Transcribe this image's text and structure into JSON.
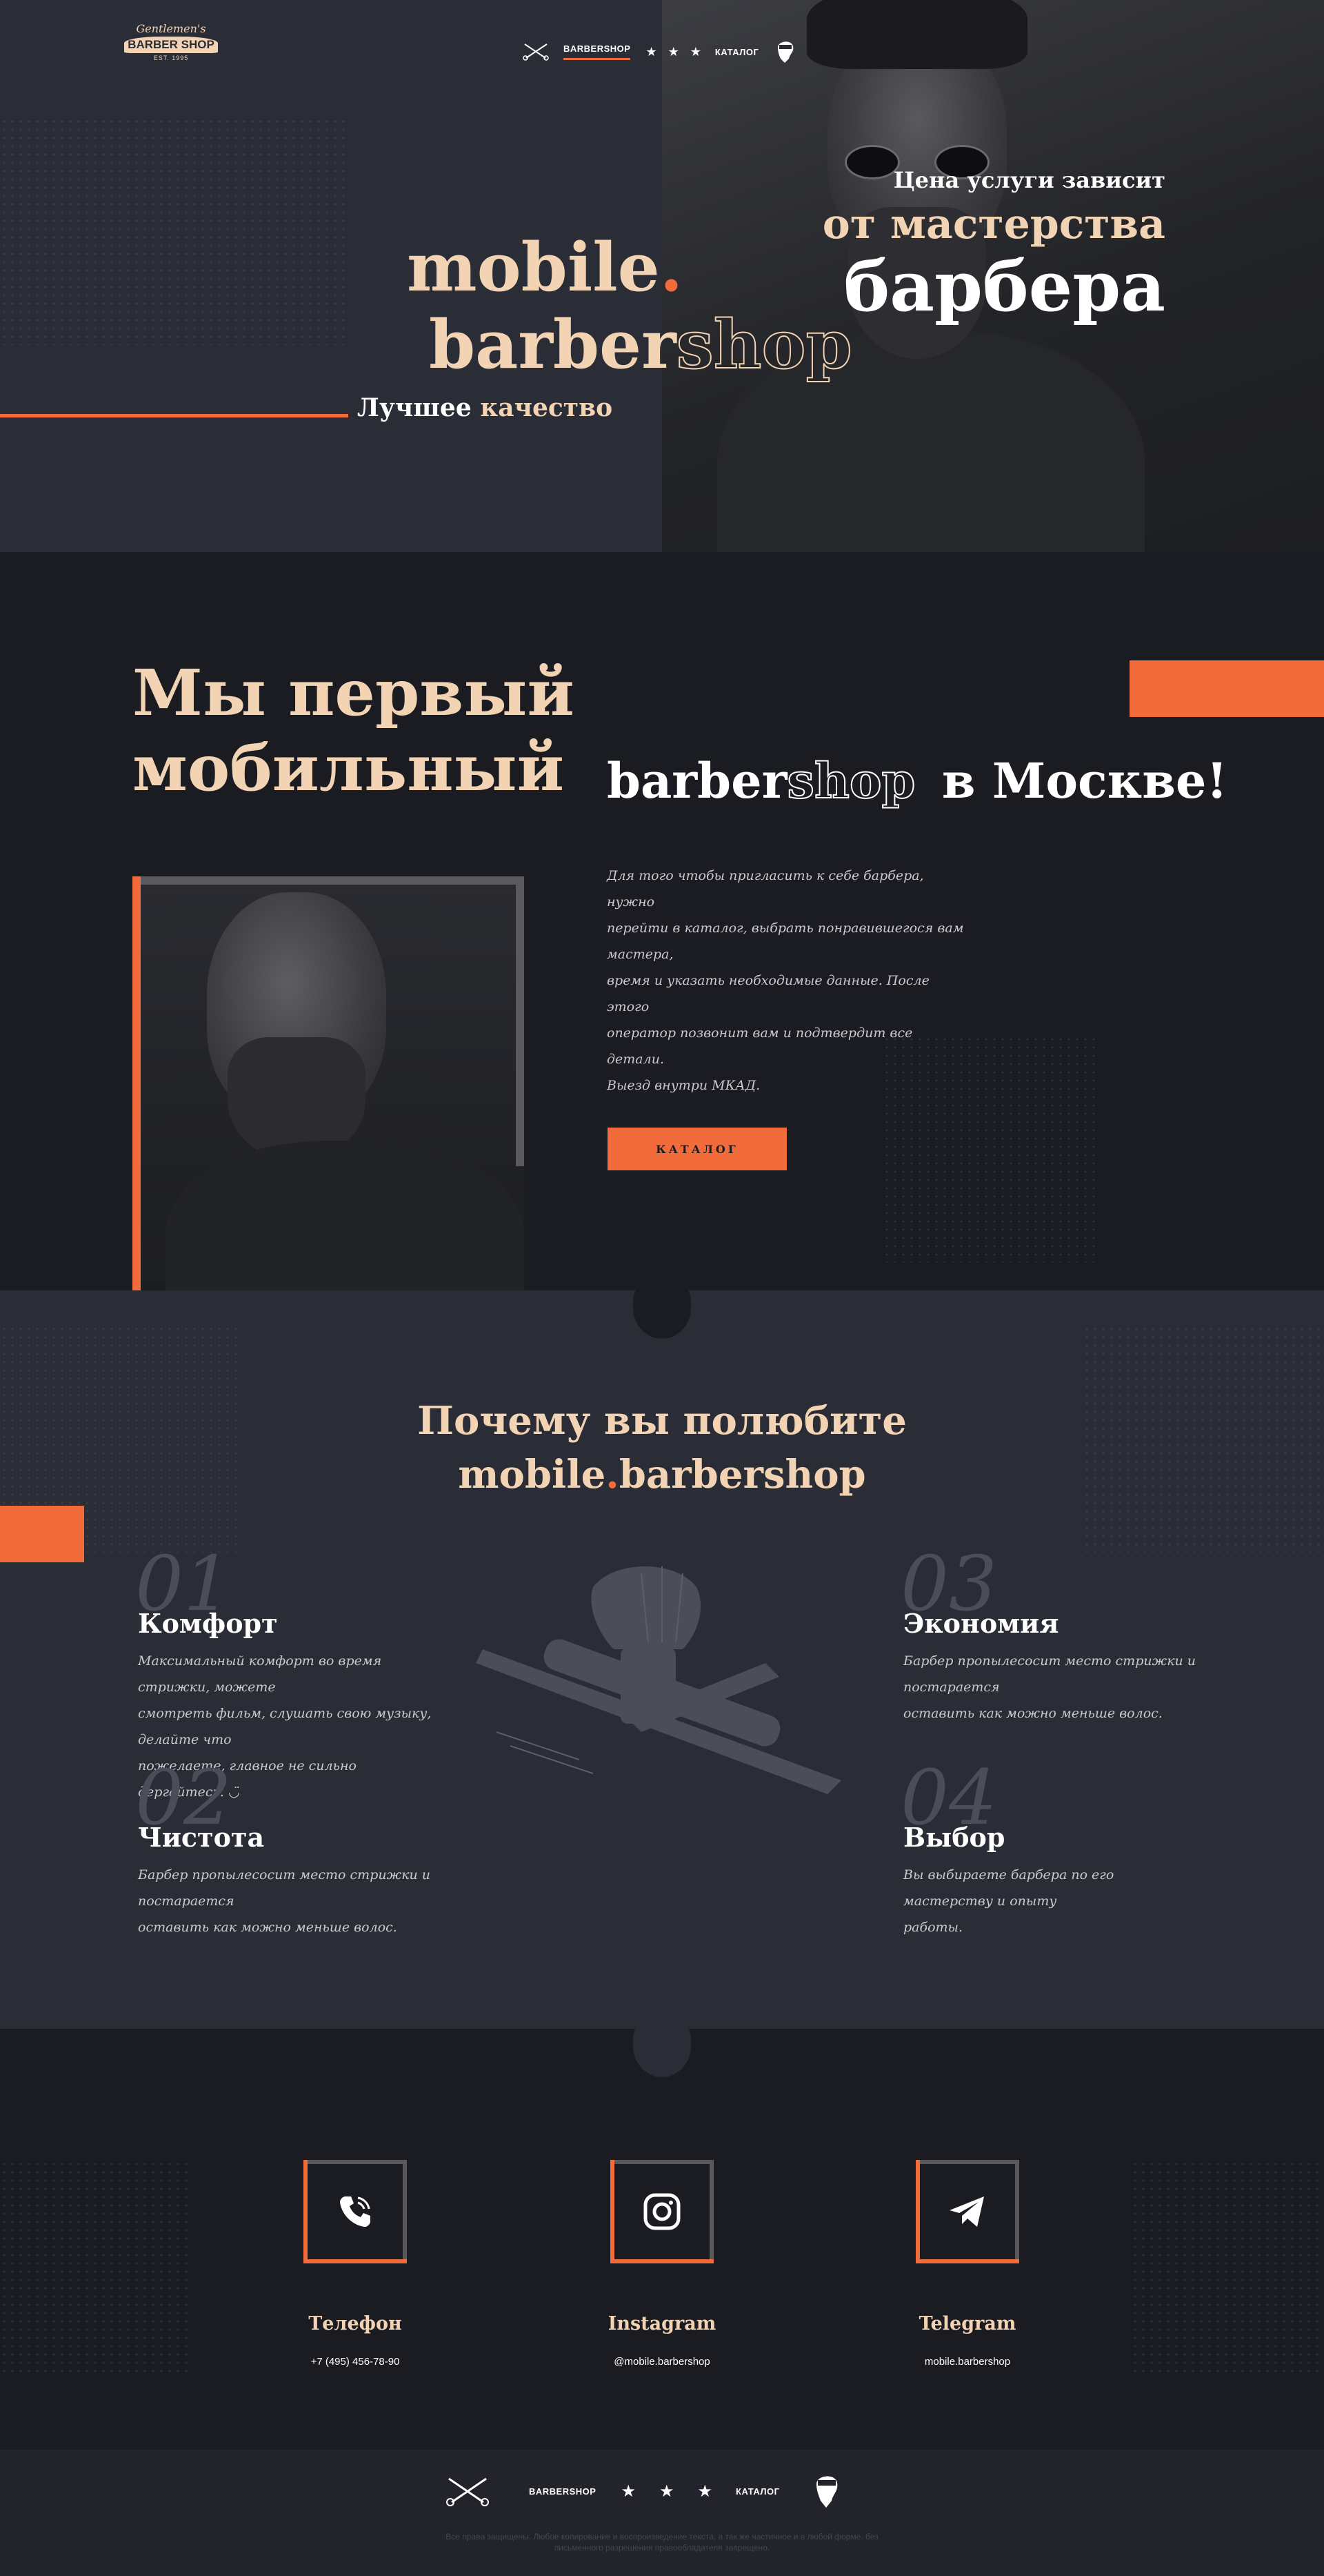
{
  "brand": {
    "logo_line1": "Gentlemen's",
    "logo_line2": "BARBER SHOP",
    "logo_line3": "EST. 1995"
  },
  "nav": {
    "barbershop": "BARBERSHOP",
    "catalog": "КАТАЛОГ",
    "stars": [
      "★",
      "★",
      "★"
    ]
  },
  "hero": {
    "title_mobile": "mobile",
    "title_dot": ".",
    "title_barber": "barber",
    "title_shop": "shop",
    "tagline_white": "Лучшее",
    "tagline_accent": "качество",
    "price_line1": "Цена услуги зависит",
    "price_line2": "от мастерства",
    "price_line3": "барбера"
  },
  "about": {
    "heading_line1": "Мы первый",
    "heading_line2": "мобильный",
    "heading_barber": "barber",
    "heading_shop": "shop",
    "heading_city": "в Москве!",
    "text_lines": [
      "Для того чтобы пригласить к себе барбера, нужно",
      "перейти в каталог, выбрать понравившегося вам мастера,",
      "время и указать необходимые данные. После этого",
      "оператор позвонит вам и подтвердит все детали.",
      "Выезд внутри МКАД."
    ],
    "catalog_button": "КАТАЛОГ"
  },
  "why": {
    "heading_line1": "Почему вы полюбите",
    "heading_mobile": "mobile",
    "heading_dot": ".",
    "heading_barbershop": "barbershop",
    "features": [
      {
        "num": "01",
        "title": "Комфорт",
        "lines": [
          "Максимальный комфорт во время стрижки, можете",
          "смотреть фильм, слушать свою музыку, делайте что",
          "пожелаете, главное не сильно дергайтесь. ◡̈"
        ]
      },
      {
        "num": "02",
        "title": "Чистота",
        "lines": [
          "Барбер пропылесосит место стрижки и постарается",
          "оставить как можно меньше волос."
        ]
      },
      {
        "num": "03",
        "title": "Экономия",
        "lines": [
          "Барбер пропылесосит место стрижки и постарается",
          "оставить как можно меньше волос."
        ]
      },
      {
        "num": "04",
        "title": "Выбор",
        "lines": [
          "Вы выбираете барбера по его мастерству и опыту",
          "работы."
        ]
      }
    ]
  },
  "contacts": [
    {
      "title": "Телефон",
      "value": "+7 (495) 456-78-90",
      "icon": "phone-icon"
    },
    {
      "title": "Instagram",
      "value": "@mobile.barbershop",
      "icon": "instagram-icon"
    },
    {
      "title": "Telegram",
      "value": "mobile.barbershop",
      "icon": "telegram-icon"
    }
  ],
  "footer": {
    "barbershop": "BARBERSHOP",
    "catalog": "КАТАЛОГ",
    "copyright_line1": "Все права защищены. Любое копирование и воспроизведение текста, а так же частичное и в любой форме, без",
    "copyright_line2": "письменного разрешения правообладателя запрещено."
  },
  "colors": {
    "accent": "#f26b3a",
    "cream": "#f2d3b3",
    "dark": "#1b1c22",
    "panel": "#2a2c36"
  }
}
